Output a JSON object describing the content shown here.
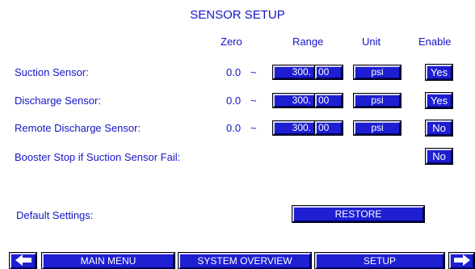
{
  "title": "SENSOR SETUP",
  "headers": {
    "zero": "Zero",
    "range": "Range",
    "unit": "Unit",
    "enable": "Enable"
  },
  "rows": [
    {
      "label": "Suction Sensor:",
      "zero": "0.0",
      "sep": "~",
      "range_int": "300.",
      "range_dec": "00",
      "unit": "psi",
      "enable": "Yes"
    },
    {
      "label": "Discharge Sensor:",
      "zero": "0.0",
      "sep": "~",
      "range_int": "300.",
      "range_dec": "00",
      "unit": "psi",
      "enable": "Yes"
    },
    {
      "label": "Remote Discharge Sensor:",
      "zero": "0.0",
      "sep": "~",
      "range_int": "300.",
      "range_dec": "00",
      "unit": "psi",
      "enable": "No"
    }
  ],
  "booster": {
    "label": "Booster Stop if Suction Sensor Fail:",
    "enable": "No"
  },
  "defaults": {
    "label": "Default Settings:",
    "button": "RESTORE"
  },
  "nav": {
    "main_menu": "MAIN MENU",
    "system_overview": "SYSTEM OVERVIEW",
    "setup": "SETUP",
    "prev_icon": "arrow-left-icon",
    "next_icon": "arrow-right-icon"
  },
  "colors": {
    "accent": "#1e1ed2",
    "text": "#1414c8",
    "background": "#ffffff"
  }
}
